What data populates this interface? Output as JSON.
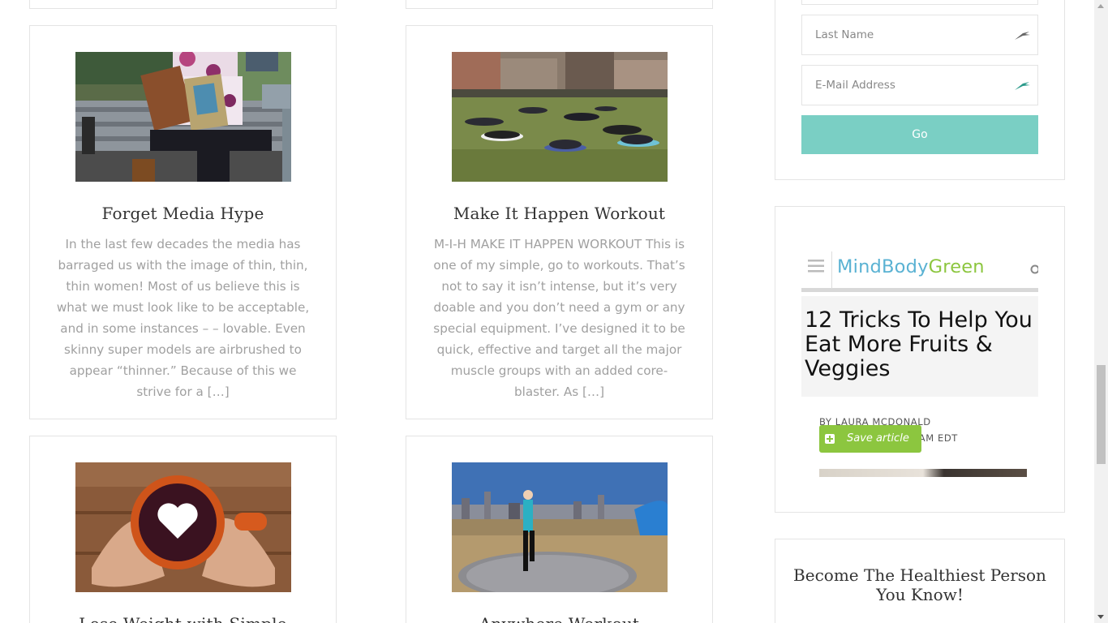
{
  "posts": [
    {
      "title": "Forget Media Hype",
      "excerpt": "In the last few decades the media has barraged us with the image of thin, thin, thin women! Most of us believe this is what we must look like to be acceptable, and in some instances – – lovable. Even skinny super models are airbrushed to appear “thinner.” Because of this we strive for a […]",
      "image": "woman-reading-on-bench"
    },
    {
      "title": "Make It Happen Workout",
      "excerpt": "M-I-H   MAKE IT HAPPEN WORKOUT This is one of my simple, go to workouts. That’s not to say it isn’t intense, but it’s very doable and you don’t need a gym or any special equipment. I’ve designed it to be quick, effective and target all the major muscle groups with an added core-blaster. As […]",
      "image": "group-workout-in-park"
    },
    {
      "title": "Lose Weight with Simple",
      "excerpt": "",
      "image": "heart-coffee-mug"
    },
    {
      "title": "Anywhere Workout",
      "excerpt": "",
      "image": "woman-stepping-waterfront"
    }
  ],
  "signup": {
    "last_name_placeholder": "Last Name",
    "email_placeholder": "E-Mail Address",
    "go_label": "Go"
  },
  "ad": {
    "logo_mind": "Mind",
    "logo_body": "Body",
    "logo_green": "Green",
    "headline": "12 Tricks To Help You Eat More Fruits & Veggies",
    "byline_author": "BY LAURA MCDONALD",
    "byline_date": "MAY 10, 2014 4:48 AM EDT",
    "save_label": "Save article"
  },
  "widget3": {
    "title": "Become The Healthiest Person You Know!"
  },
  "colors": {
    "accent": "#7acfc4",
    "border": "#e4e4e4",
    "text_muted": "#a0a0a0",
    "heading": "#333333",
    "mbg_blue": "#5ab2d3",
    "mbg_green": "#8cc63f"
  }
}
